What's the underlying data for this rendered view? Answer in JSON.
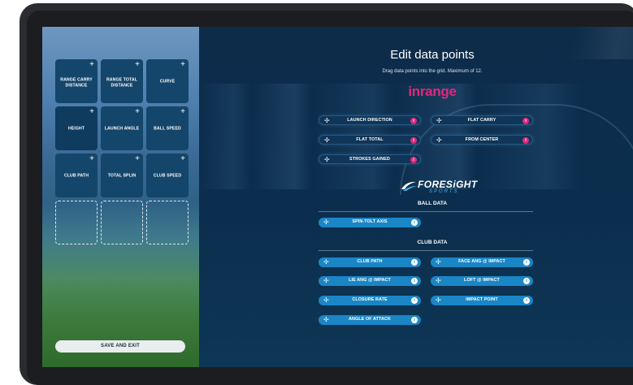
{
  "editor": {
    "title": "Edit data points",
    "subtitle": "Drag data points into the grid. Maximum of 12.",
    "save_label": "SAVE AND EXIT"
  },
  "grid": {
    "tiles": [
      {
        "label": "RANGE CARRY\nDISTANCE",
        "icon": "move-icon"
      },
      {
        "label": "RANGE TOTAL\nDISTANCE",
        "icon": "move-icon"
      },
      {
        "label": "CURVE",
        "icon": "move-icon"
      },
      {
        "label": "HEIGHT",
        "icon": "move-icon"
      },
      {
        "label": "LAUNCH ANGLE",
        "icon": "move-icon"
      },
      {
        "label": "BALL SPEED",
        "icon": "move-icon"
      },
      {
        "label": "CLUB PATH",
        "icon": "move-icon"
      },
      {
        "label": "TOTAL SPLIN",
        "icon": "move-icon"
      },
      {
        "label": "CLUB SPEED",
        "icon": "move-icon"
      }
    ],
    "empty_slots": 3
  },
  "inrange": {
    "logo": "inrange",
    "items": [
      {
        "label": "LAUNCH DIRECTION"
      },
      {
        "label": "FLAT CARRY"
      },
      {
        "label": "FLAT TOTAL"
      },
      {
        "label": "FROM CENTER"
      },
      {
        "label": "STROKES GAINED"
      }
    ]
  },
  "foresight": {
    "logo": "FORESiGHT",
    "logo_sub": "SPORTS",
    "ball_heading": "BALL DATA",
    "ball_items": [
      {
        "label": "SPIN-TOLT AXIS"
      }
    ],
    "club_heading": "CLUB DATA",
    "club_items": [
      {
        "label": "CLUB PATH"
      },
      {
        "label": "FACE ANG @ IMPACT"
      },
      {
        "label": "LIE ANG @ IMPACT"
      },
      {
        "label": "LOFT @ IMPACT"
      },
      {
        "label": "CLOSURE RATE"
      },
      {
        "label": "IMPACT POINT"
      },
      {
        "label": "ANGLE OF ATTACK"
      }
    ]
  },
  "icons": {
    "move": "✢",
    "plus": "+",
    "info": "i"
  },
  "colors": {
    "inrange_accent": "#e0287e",
    "foresight_blue": "#1a86c6",
    "tile": "#14456a"
  }
}
